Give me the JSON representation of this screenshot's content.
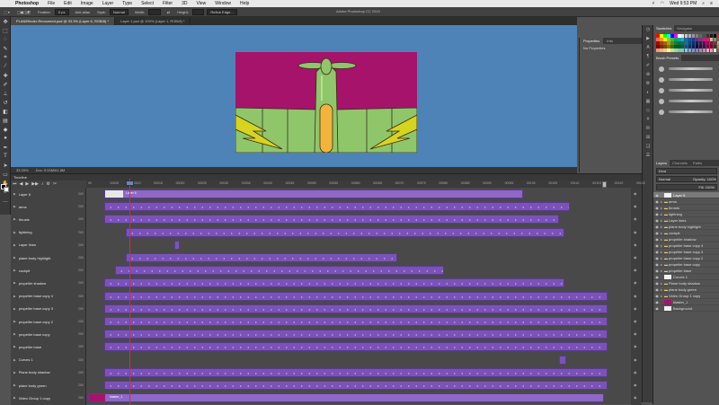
{
  "menubar": {
    "app": "Photoshop",
    "items": [
      "File",
      "Edit",
      "Image",
      "Layer",
      "Type",
      "Select",
      "Filter",
      "3D",
      "View",
      "Window",
      "Help"
    ],
    "clock": "Wed 9:53 PM",
    "battery": "⚡"
  },
  "options_bar": {
    "feather_label": "Feather:",
    "feather_value": "0 px",
    "anti_alias": "Anti-alias",
    "style_label": "Style:",
    "style_value": "Normal",
    "width_label": "Width:",
    "height_label": "Height:",
    "refine_edge": "Refine Edge...",
    "window_title": "Adobe Photoshop CC 2015"
  },
  "doc_tabs": [
    {
      "label": "PLANEfinder-Recovered.psd @ 33.3% (Layer 6, RGB/8) *",
      "active": true
    },
    {
      "label": "Layer 1.psd @ 100% (Layer 1, RGB/8) *",
      "active": false
    }
  ],
  "status": {
    "zoom": "33.33%",
    "doc": "Doc: 5.93M/61.8M"
  },
  "properties": {
    "tabs": [
      "Properties",
      "Info"
    ],
    "empty": "No Properties"
  },
  "swatches_panel": {
    "tabs": [
      "Swatches",
      "Navigator"
    ],
    "colors": [
      "#ff0000",
      "#ffff00",
      "#00ff00",
      "#00ffff",
      "#0000ff",
      "#ff00ff",
      "#ffffff",
      "#e6e6e6",
      "#cccccc",
      "#b3b3b3",
      "#999999",
      "#808080",
      "#666666",
      "#4d4d4d",
      "#333333",
      "#1a1a1a",
      "#000000",
      "#ed1c24",
      "#f26c4f",
      "#f7941d",
      "#fff200",
      "#8dc63f",
      "#39b54a",
      "#00a651",
      "#00a99d",
      "#00aeef",
      "#0072bc",
      "#0054a6",
      "#2e3192",
      "#662d91",
      "#92278f",
      "#ec008c",
      "#ed145b",
      "#c7b299",
      "#998675",
      "#736357",
      "#9e0b0f",
      "#a0410d",
      "#a36209",
      "#aba000",
      "#598527",
      "#1a7b30",
      "#007236",
      "#00746b",
      "#0076a3",
      "#004a80",
      "#003471",
      "#1b1464",
      "#440e62",
      "#630460",
      "#9e005d",
      "#9e0039",
      "#534741",
      "#c69c6d",
      "#790000",
      "#7b2e00",
      "#7d4900",
      "#827b00",
      "#406618",
      "#005e20",
      "#005826",
      "#005952",
      "#005b7f",
      "#003663",
      "#002157",
      "#0d004c",
      "#32004b",
      "#4b0049",
      "#7b0046",
      "#7a0026",
      "#362f2d",
      "#a67c52",
      "#f69679",
      "#f9ad81",
      "#fdc68a",
      "#fff799",
      "#c4df9b",
      "#a3d39c",
      "#82ca9d",
      "#7accc8",
      "#6dcff6",
      "#7da7d9",
      "#8393ca",
      "#8781bd",
      "#a186be",
      "#bd8cbf",
      "#f49ac1",
      "#f5989d",
      "#e6e6e6",
      "#8c6239"
    ],
    "brush_presets_label": "Brush Presets"
  },
  "layers_panel": {
    "tabs": [
      "Layers",
      "Channels",
      "Paths"
    ],
    "kind": "Kind",
    "blend": "Normal",
    "opacity": "Opacity: 100%",
    "fill": "Fill: 100%",
    "rows": [
      {
        "name": "Layer 6",
        "selected": true,
        "type": "layer"
      },
      {
        "name": "arms",
        "type": "folder"
      },
      {
        "name": "thrusts",
        "type": "folder"
      },
      {
        "name": "lightning",
        "type": "folder"
      },
      {
        "name": "Layer lines",
        "type": "folder"
      },
      {
        "name": "plane body highlight",
        "type": "folder"
      },
      {
        "name": "cockpit",
        "type": "folder"
      },
      {
        "name": "propeller shadow",
        "type": "folder"
      },
      {
        "name": "propeller base copy 4",
        "type": "folder"
      },
      {
        "name": "propeller base copy 3",
        "type": "folder"
      },
      {
        "name": "propeller base copy 2",
        "type": "folder"
      },
      {
        "name": "propeller base copy",
        "type": "folder"
      },
      {
        "name": "propeller base",
        "type": "folder"
      },
      {
        "name": "Curves 1",
        "type": "adjust"
      },
      {
        "name": "Plane body shadow",
        "type": "folder"
      },
      {
        "name": "plane body green",
        "type": "folder"
      },
      {
        "name": "Video Group 1 copy",
        "type": "folder"
      },
      {
        "name": "blaster_1",
        "type": "layer"
      },
      {
        "name": "Background",
        "type": "layer"
      }
    ]
  },
  "timeline": {
    "title": "Timeline",
    "ruler_ticks": [
      "00",
      "00005",
      "00010",
      "00015",
      "00020",
      "00025",
      "00030",
      "00035",
      "00040",
      "00045",
      "00050",
      "00055",
      "00060",
      "00065",
      "00070",
      "00075",
      "00080",
      "00085",
      "00090",
      "00095",
      "00100",
      "00105",
      "00110",
      "00115",
      "00120",
      "00125"
    ],
    "tracks": [
      {
        "name": "Layer 6",
        "clip_label": "Layer 6",
        "start": 20,
        "end": 486,
        "dots": false,
        "white": true
      },
      {
        "name": "arms",
        "start": 20,
        "end": 538,
        "dots": true
      },
      {
        "name": "thrusts",
        "start": 20,
        "end": 526,
        "dots": true
      },
      {
        "name": "lightning",
        "start": 44,
        "end": 532,
        "dots": true
      },
      {
        "name": "Layer lines",
        "start": 98,
        "end": 104,
        "dots": false
      },
      {
        "name": "plane body highlight",
        "start": 44,
        "end": 346,
        "dots": true
      },
      {
        "name": "cockpit",
        "start": 32,
        "end": 398,
        "dots": true
      },
      {
        "name": "propeller shadow",
        "start": 20,
        "end": 532,
        "dots": true
      },
      {
        "name": "propeller base copy 4",
        "start": 20,
        "end": 580,
        "dots": true
      },
      {
        "name": "propeller base copy 3",
        "start": 20,
        "end": 580,
        "dots": true
      },
      {
        "name": "propeller base copy 2",
        "start": 20,
        "end": 580,
        "dots": true
      },
      {
        "name": "propeller base copy",
        "start": 20,
        "end": 580,
        "dots": true
      },
      {
        "name": "propeller base",
        "start": 20,
        "end": 580,
        "dots": true
      },
      {
        "name": "Curves 1",
        "start": 526,
        "end": 534,
        "dots": false
      },
      {
        "name": "Plane body shadow",
        "start": 20,
        "end": 580,
        "dots": true
      },
      {
        "name": "plane body green",
        "start": 20,
        "end": 580,
        "dots": true
      },
      {
        "name": "Video Group 1 copy",
        "clip_label": "blaster_1",
        "start": 2,
        "end": 576,
        "dots": false,
        "thumb": true
      }
    ]
  },
  "colors": {
    "canvas_bg": "#4d83b7",
    "clip_purple": "#7b53b8",
    "playhead": "#d02f3a",
    "art_magenta": "#a6136b",
    "plane_green": "#8fc66a",
    "plane_yellow": "#d6d41f"
  }
}
